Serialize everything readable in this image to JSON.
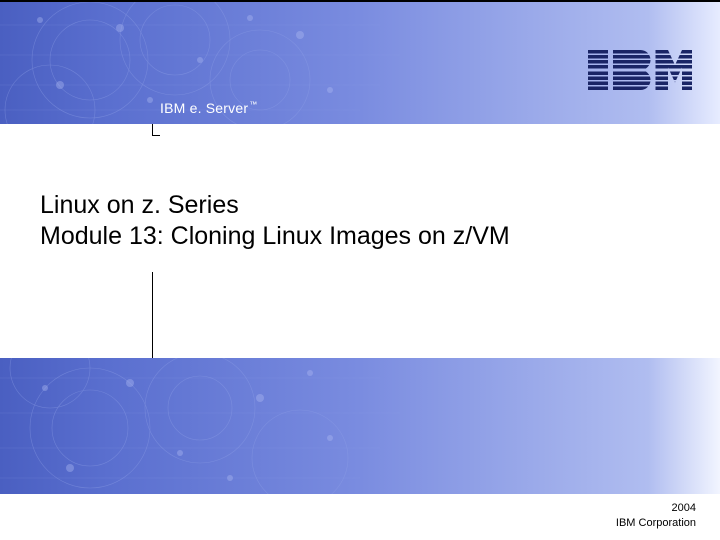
{
  "brand": {
    "logo_name": "IBM",
    "product_line_prefix": "IBM e. Server",
    "tm": "™"
  },
  "title": {
    "line1": "Linux on z. Series",
    "line2": "Module 13:  Cloning Linux Images on z/VM"
  },
  "footer": {
    "year": "2004",
    "org": "IBM Corporation"
  },
  "colors": {
    "band_start": "#4a5fc1",
    "band_end": "#e7ecff",
    "text": "#000000",
    "header_text": "#ffffff"
  }
}
